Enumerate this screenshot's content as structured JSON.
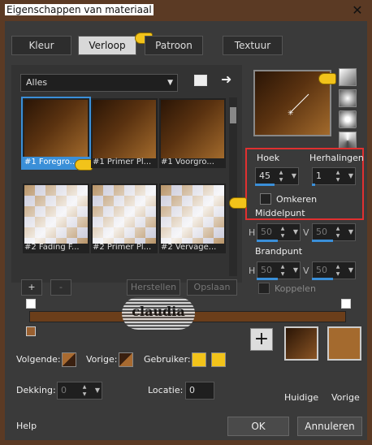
{
  "window": {
    "title": "Eigenschappen van materiaal",
    "close": "✕"
  },
  "tabs": [
    {
      "label": "Kleur"
    },
    {
      "label": "Verloop"
    },
    {
      "label": "Patroon"
    },
    {
      "label": "Textuur"
    }
  ],
  "library": {
    "filter": "Alles",
    "tiles": [
      {
        "label": "#1 Foregro..."
      },
      {
        "label": "#1 Primer Pl..."
      },
      {
        "label": "#1 Voorgro..."
      },
      {
        "label": "#2 Fading F..."
      },
      {
        "label": "#2 Primer Pl..."
      },
      {
        "label": "#2 Vervage..."
      }
    ],
    "buttons": {
      "add": "+",
      "remove": "-",
      "restore": "Herstellen",
      "save": "Opslaan"
    }
  },
  "gradient": {
    "angle_label": "Hoek",
    "angle": "45",
    "repeats_label": "Herhalingen",
    "repeats": "1",
    "invert_label": "Omkeren",
    "center_label": "Middelpunt",
    "center_h": "50",
    "center_v": "50",
    "focal_label": "Brandpunt",
    "focal_h": "50",
    "focal_v": "50",
    "link_label": "Koppelen",
    "h": "H",
    "v": "V"
  },
  "ramp": {
    "next_label": "Volgende:",
    "prev_label": "Vorige:",
    "user_label": "Gebruiker:",
    "opacity_label": "Dekking:",
    "opacity": "0",
    "location_label": "Locatie:",
    "location": "0"
  },
  "swatches": {
    "current_label": "Huidige",
    "previous_label": "Vorige",
    "current_color": "#3b200b",
    "previous_color": "#a46a2e"
  },
  "footer": {
    "help": "Help",
    "ok": "OK",
    "cancel": "Annuleren"
  },
  "watermark": {
    "text": "claudia"
  }
}
